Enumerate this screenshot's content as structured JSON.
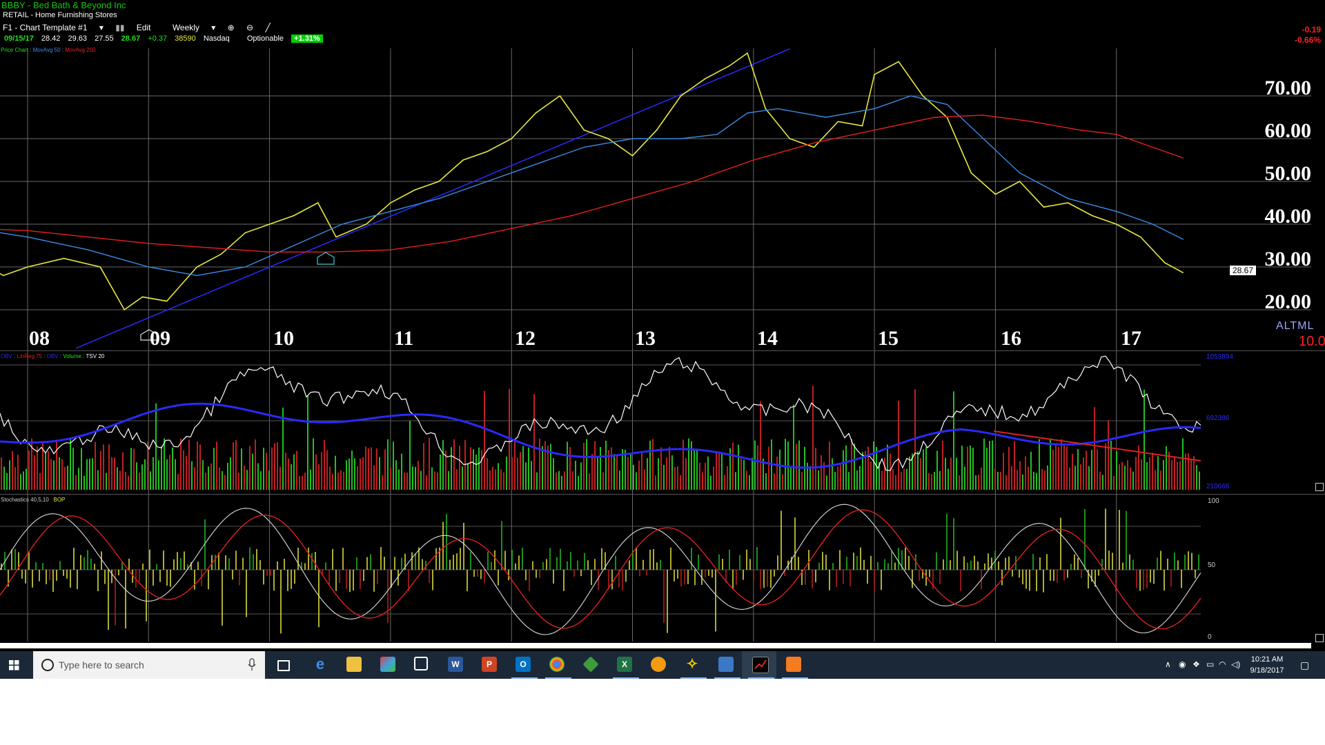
{
  "header": {
    "symbol_line": "BBBY - Bed Bath & Beyond Inc",
    "industry": "RETAIL - Home Furnishing Stores",
    "template": "F1 - Chart Template #1",
    "edit_label": "Edit",
    "period": "Weekly"
  },
  "quote": {
    "date": "09/15/17",
    "open": "28.42",
    "high": "29.63",
    "low": "27.55",
    "close": "28.67",
    "change": "+0.37",
    "volume": "38590",
    "exchange": "Nasdaq",
    "optionable": "Optionable",
    "pct_badge": "+1.31%"
  },
  "change_readout": {
    "points": "-0.19",
    "percent": "-0.66%"
  },
  "price_legend": [
    {
      "text": "Price Chart",
      "color": "#22e022"
    },
    {
      "text": "MovAvg 50",
      "color": "#3a8de8"
    },
    {
      "text": "MovAvg 200",
      "color": "#e82020"
    }
  ],
  "volume_legend": [
    {
      "text": "OBV",
      "color": "#2a2aff"
    },
    {
      "text": "LinReg 75",
      "color": "#e82020"
    },
    {
      "text": "OBV",
      "color": "#2a2aff"
    },
    {
      "text": "Volume",
      "color": "#22e022"
    },
    {
      "text": "TSV 20",
      "color": "#ffffff"
    }
  ],
  "stoch_legend": [
    {
      "text": "Stochastics 40,5,10",
      "color": "#cccccc"
    },
    {
      "text": "BOP",
      "color": "#e8e840"
    }
  ],
  "price_axis": [
    "70.00",
    "60.00",
    "50.00",
    "40.00",
    "30.00",
    "20.00"
  ],
  "last_price": "28.67",
  "years": [
    "08",
    "09",
    "10",
    "11",
    "12",
    "13",
    "14",
    "15",
    "16",
    "17"
  ],
  "altml": "ALTML",
  "altml_value": "10.0",
  "volume_scale": [
    "1053894",
    "692386",
    "210666"
  ],
  "stoch_scale": [
    "100",
    "50",
    "0"
  ],
  "chart_data": {
    "type": "line",
    "series": [
      {
        "name": "Price Chart",
        "color": "#e8e840",
        "x": [
          2007.55,
          2007.8,
          2008.0,
          2008.3,
          2008.6,
          2008.8,
          2008.95,
          2009.15,
          2009.4,
          2009.6,
          2009.8,
          2010.0,
          2010.2,
          2010.4,
          2010.55,
          2010.8,
          2011.0,
          2011.2,
          2011.4,
          2011.6,
          2011.8,
          2012.0,
          2012.2,
          2012.4,
          2012.6,
          2012.8,
          2013.0,
          2013.2,
          2013.4,
          2013.6,
          2013.8,
          2013.95,
          2014.1,
          2014.3,
          2014.5,
          2014.7,
          2014.9,
          2015.0,
          2015.2,
          2015.4,
          2015.6,
          2015.8,
          2016.0,
          2016.2,
          2016.4,
          2016.6,
          2016.8,
          2017.0,
          2017.2,
          2017.4,
          2017.55
        ],
        "y": [
          32,
          28,
          30,
          32,
          30,
          20,
          23,
          22,
          30,
          33,
          38,
          40,
          42,
          45,
          37,
          40,
          45,
          48,
          50,
          55,
          57,
          60,
          66,
          70,
          62,
          60,
          56,
          62,
          70,
          74,
          77,
          80,
          67,
          60,
          58,
          64,
          63,
          75,
          78,
          70,
          65,
          52,
          47,
          50,
          44,
          45,
          42,
          40,
          37,
          31,
          28.67
        ]
      },
      {
        "name": "MovAvg 50",
        "color": "#3a8de8",
        "x": [
          2007.55,
          2008.0,
          2008.5,
          2009.0,
          2009.4,
          2009.8,
          2010.2,
          2010.6,
          2011.0,
          2011.4,
          2011.8,
          2012.2,
          2012.6,
          2013.0,
          2013.4,
          2013.7,
          2013.95,
          2014.2,
          2014.6,
          2015.0,
          2015.3,
          2015.6,
          2015.9,
          2016.2,
          2016.6,
          2017.0,
          2017.3,
          2017.55
        ],
        "y": [
          39,
          37,
          34,
          30,
          28,
          30,
          35,
          40,
          43,
          46,
          50,
          54,
          58,
          60,
          60,
          61,
          66,
          67,
          65,
          67,
          70,
          68,
          60,
          52,
          46,
          43,
          40,
          36.5
        ]
      },
      {
        "name": "MovAvg 200",
        "color": "#e82020",
        "x": [
          2007.55,
          2008.0,
          2008.5,
          2009.0,
          2009.5,
          2010.0,
          2010.5,
          2011.0,
          2011.5,
          2012.0,
          2012.5,
          2013.0,
          2013.5,
          2014.0,
          2014.5,
          2015.0,
          2015.5,
          2015.9,
          2016.3,
          2016.7,
          2017.0,
          2017.3,
          2017.55
        ],
        "y": [
          39,
          38.5,
          37,
          35.5,
          34.5,
          33.5,
          33.5,
          34,
          36,
          39,
          42,
          46,
          50,
          55,
          59,
          62,
          65,
          65.5,
          64,
          62,
          61,
          58,
          55.5
        ]
      }
    ],
    "xlabel": "",
    "ylabel": "",
    "xlim": [
      2007.55,
      2017.6
    ],
    "ylim": [
      15,
      80
    ]
  },
  "taskbar": {
    "search_placeholder": "Type here to search",
    "time": "10:21 AM",
    "date": "9/18/2017",
    "apps": [
      "task-view",
      "edge",
      "file-explorer",
      "photos",
      "store",
      "word",
      "powerpoint",
      "outlook",
      "chrome",
      "network-tool",
      "excel",
      "messenger",
      "runner",
      "vmware",
      "stock-chart",
      "office-app"
    ]
  }
}
